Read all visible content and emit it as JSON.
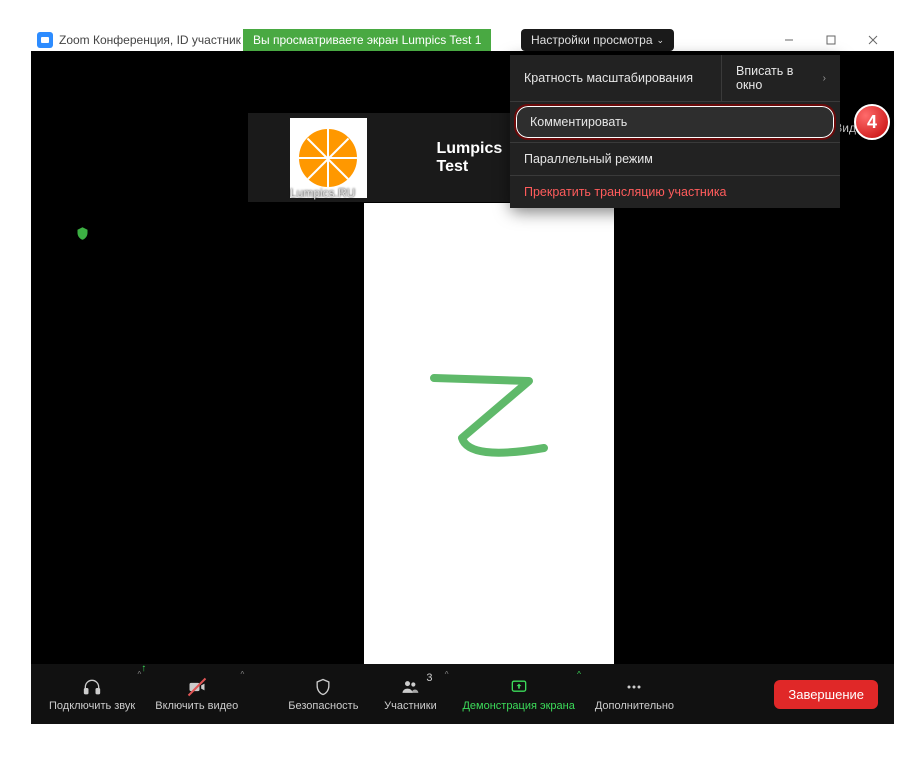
{
  "titlebar": {
    "title": "Zoom Конференция, ID участник"
  },
  "banner": {
    "viewing": "Вы просматриваете экран Lumpics Test 1",
    "settings": "Настройки просмотра"
  },
  "menu": {
    "zoom_ratio": "Кратность масштабирования",
    "fit_window": "Вписать в окно",
    "annotate": "Комментировать",
    "side_by_side": "Параллельный режим",
    "stop_share": "Прекратить трансляцию участника"
  },
  "step_badge": "4",
  "view_button": "Вид",
  "tile": {
    "name": "Lumpics.RU",
    "label": "Lumpics Test"
  },
  "toolbar": {
    "join_audio": "Подключить звук",
    "start_video": "Включить видео",
    "security": "Безопасность",
    "participants": "Участники",
    "participants_count": "3",
    "share": "Демонстрация экрана",
    "more": "Дополнительно",
    "end": "Завершение"
  }
}
